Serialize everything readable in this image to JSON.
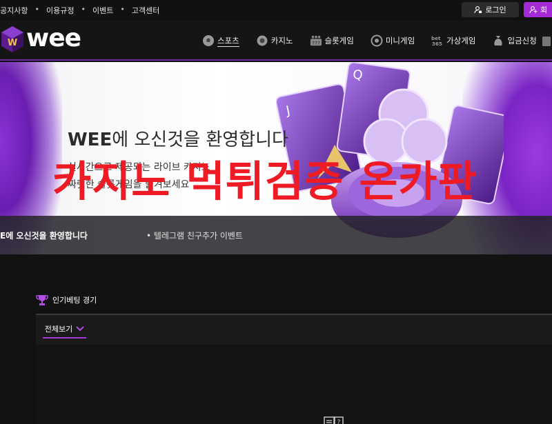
{
  "topbar": {
    "links": [
      "공지사항",
      "이용규정",
      "이벤트",
      "고객센터"
    ],
    "login_label": "로그인",
    "join_label": "회"
  },
  "nav": {
    "logo_text": "wee",
    "items": [
      {
        "label": "스포츠",
        "icon": "soccer-ball-icon"
      },
      {
        "label": "카지노",
        "icon": "chip-icon"
      },
      {
        "label": "슬롯게임",
        "icon": "slot-777-icon"
      },
      {
        "label": "미니게임",
        "icon": "coin-icon"
      },
      {
        "label": "가상게임",
        "icon": "bet365-icon"
      },
      {
        "label": "입금신청",
        "icon": "money-bag-icon"
      }
    ]
  },
  "banner": {
    "title_bold": "WEE",
    "title_rest": "에 오신것을 환영합니다",
    "sub1": "실시간으로 제공되는 라이브 카지노",
    "sub2": "짜릿한 슬롯게임을 즐겨보세요",
    "overlay": "카지노 먹튀검증 온카판",
    "ticker_a": "E에 오신것을 환영합니다",
    "ticker_b": "• 텔레그램 친구추가 이벤트"
  },
  "section": {
    "title": "인기베팅 경기",
    "tab_all": "전체보기"
  },
  "colors": {
    "accent": "#a42ad8",
    "overlay": "#ee1b25"
  }
}
